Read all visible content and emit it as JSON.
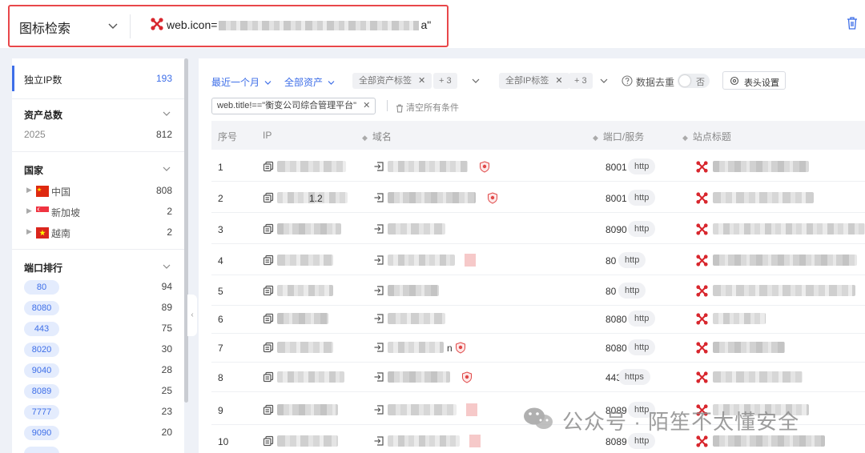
{
  "search": {
    "type_label": "图标检索",
    "query_prefix": "web.icon=",
    "query_suffix": "a\""
  },
  "sidebar": {
    "ip_label": "独立IP数",
    "ip_count": "193",
    "asset_total": {
      "title": "资产总数",
      "rows": [
        {
          "label": "2025",
          "value": "812"
        }
      ]
    },
    "country": {
      "title": "国家",
      "rows": [
        {
          "name": "中国",
          "value": "808",
          "flag": "china"
        },
        {
          "name": "新加坡",
          "value": "2",
          "flag": "singapore"
        },
        {
          "name": "越南",
          "value": "2",
          "flag": "vietnam"
        }
      ]
    },
    "ports": {
      "title": "端口排行",
      "rows": [
        {
          "port": "80",
          "value": "94"
        },
        {
          "port": "8080",
          "value": "89"
        },
        {
          "port": "443",
          "value": "75"
        },
        {
          "port": "8020",
          "value": "30"
        },
        {
          "port": "9040",
          "value": "28"
        },
        {
          "port": "8089",
          "value": "25"
        },
        {
          "port": "7777",
          "value": "23"
        },
        {
          "port": "9090",
          "value": "20"
        }
      ]
    }
  },
  "toolbar": {
    "time_filter": "最近一个月",
    "asset_filter": "全部资产",
    "asset_tag": "全部资产标签",
    "asset_tag_more": "+ 3",
    "ip_tag": "全部IP标签",
    "ip_tag_more": "+ 3",
    "dedup_label": "数据去重",
    "dedup_state": "否",
    "column_settings": "表头设置",
    "condition": "web.title!==\"衡变公司综合管理平台\"",
    "clear_all": "清空所有条件"
  },
  "table": {
    "headers": {
      "index": "序号",
      "ip": "IP",
      "domain": "域名",
      "port": "端口/服务",
      "title": "站点标题"
    },
    "rows": [
      {
        "index": "1",
        "ip_tail": "",
        "domain_tail": "",
        "port": "8001",
        "protocol": "http",
        "shield": true,
        "title_tail": ""
      },
      {
        "index": "2",
        "ip_tail": "1.2",
        "domain_tail": "",
        "port": "8001",
        "protocol": "http",
        "shield": true,
        "title_tail": ""
      },
      {
        "index": "3",
        "ip_tail": "",
        "domain_tail": "",
        "port": "8090",
        "protocol": "http",
        "shield": false,
        "title_tail": ""
      },
      {
        "index": "4",
        "ip_tail": "",
        "domain_tail": "",
        "port": "80",
        "protocol": "http",
        "shield": false,
        "title_tail": ""
      },
      {
        "index": "5",
        "ip_tail": "",
        "domain_tail": "",
        "port": "80",
        "protocol": "http",
        "shield": false,
        "title_tail": ""
      },
      {
        "index": "6",
        "ip_tail": "",
        "domain_tail": "",
        "port": "8080",
        "protocol": "http",
        "shield": false,
        "title_tail": ""
      },
      {
        "index": "7",
        "ip_tail": "",
        "domain_tail": "n",
        "port": "8080",
        "protocol": "http",
        "shield": true,
        "title_tail": ""
      },
      {
        "index": "8",
        "ip_tail": "",
        "domain_tail": "",
        "port": "443",
        "protocol": "https",
        "shield": true,
        "title_tail": ""
      },
      {
        "index": "9",
        "ip_tail": "",
        "domain_tail": "",
        "port": "8089",
        "protocol": "http",
        "shield": false,
        "title_tail": ""
      },
      {
        "index": "10",
        "ip_tail": "",
        "domain_tail": "",
        "port": "8089",
        "protocol": "http",
        "shield": false,
        "title_tail": ""
      }
    ]
  },
  "watermark": {
    "text": "公众号 · 陌笙不太懂安全"
  },
  "colors": {
    "accent": "#3d6ee8",
    "highlight_border": "#e8474a",
    "icon_red": "#d8272e"
  }
}
